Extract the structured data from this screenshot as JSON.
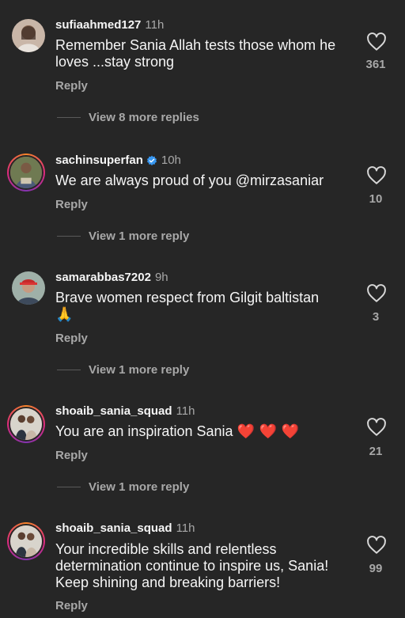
{
  "comments": [
    {
      "username": "sufiaahmed127",
      "time": "11h",
      "text": "Remember Sania Allah tests those whom he loves ...stay strong",
      "reply_label": "Reply",
      "likes": "361",
      "more_replies": "View 8 more replies",
      "verified": false
    },
    {
      "username": "sachinsuperfan",
      "time": "10h",
      "text": "We are always proud of you @mirzasaniar",
      "reply_label": "Reply",
      "likes": "10",
      "more_replies": "View 1 more reply",
      "verified": true
    },
    {
      "username": "samarabbas7202",
      "time": "9h",
      "text": "Brave women respect from Gilgit baltistan",
      "text_emoji": "🙏",
      "reply_label": "Reply",
      "likes": "3",
      "more_replies": "View 1 more reply",
      "verified": false
    },
    {
      "username": "shoaib_sania_squad",
      "time": "11h",
      "text": "You are an inspiration Sania",
      "text_emoji": "❤️ ❤️ ❤️",
      "reply_label": "Reply",
      "likes": "21",
      "more_replies": "View 1 more reply",
      "verified": false
    },
    {
      "username": "shoaib_sania_squad",
      "time": "11h",
      "text": "Your incredible skills and relentless determination continue to inspire us, Sania! Keep shining and breaking barriers!",
      "reply_label": "Reply",
      "likes": "99",
      "verified": false
    }
  ],
  "colors": {
    "background": "#262626",
    "primary_text": "#f5f5f5",
    "secondary_text": "#a8a8a8",
    "verified_badge": "#3897f0",
    "heart_red": "#e0242c"
  },
  "icons": {
    "like": "heart-outline-icon",
    "verified": "verified-badge-icon"
  }
}
